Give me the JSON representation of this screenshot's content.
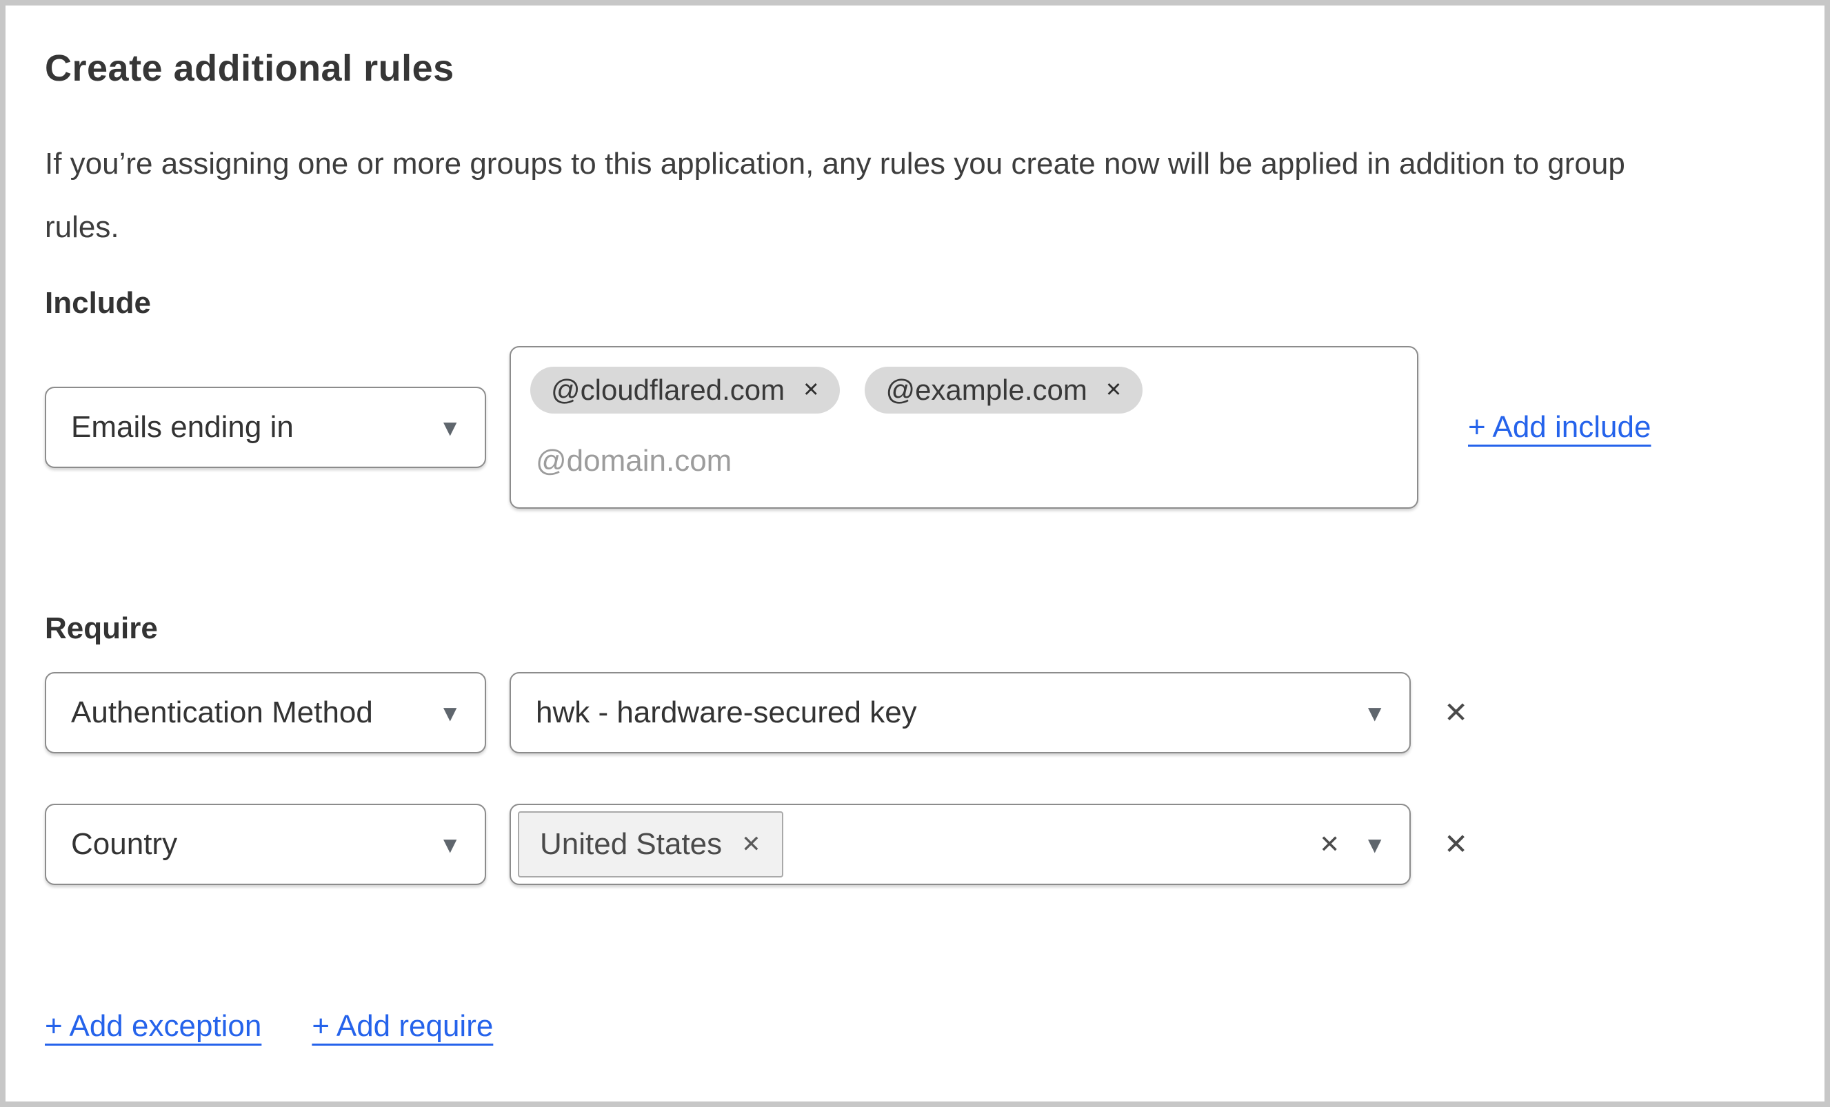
{
  "window": {
    "frame_color": "#c7c7c7",
    "background_color": "#ffffff"
  },
  "header": {
    "title": "Create additional rules",
    "description_line1": "If you’re assigning one or more groups to this application, any rules you create now will be applied in addition to group",
    "description_line2": "rules."
  },
  "include": {
    "label": "Include",
    "rule_type_selected": "Emails ending in",
    "tags": [
      "@cloudflared.com",
      "@example.com"
    ],
    "input_placeholder": "@domain.com",
    "add_link_label": "+ Add include"
  },
  "require": {
    "label": "Require",
    "rule1": {
      "rule_type_selected": "Authentication Method",
      "value_selected": "hwk - hardware-secured key"
    },
    "rule2": {
      "rule_type_selected": "Country",
      "tag": "United States"
    }
  },
  "footer": {
    "add_exception_label": "+ Add exception",
    "add_require_label": "+ Add require"
  },
  "icons": {
    "caret": "▼",
    "tag_remove": "✕",
    "clear": "✕",
    "row_remove": "✕"
  },
  "colors": {
    "link_blue": "#2563eb",
    "input_border": "#8c8c8c",
    "pill_background": "#d9d9d9",
    "country_tag_background": "#f1f1f1",
    "country_tag_border": "#a9a9a9",
    "text": "#363636",
    "placeholder": "#9c9c9c",
    "caret": "#5f666d",
    "frame": "#c7c7c7"
  }
}
